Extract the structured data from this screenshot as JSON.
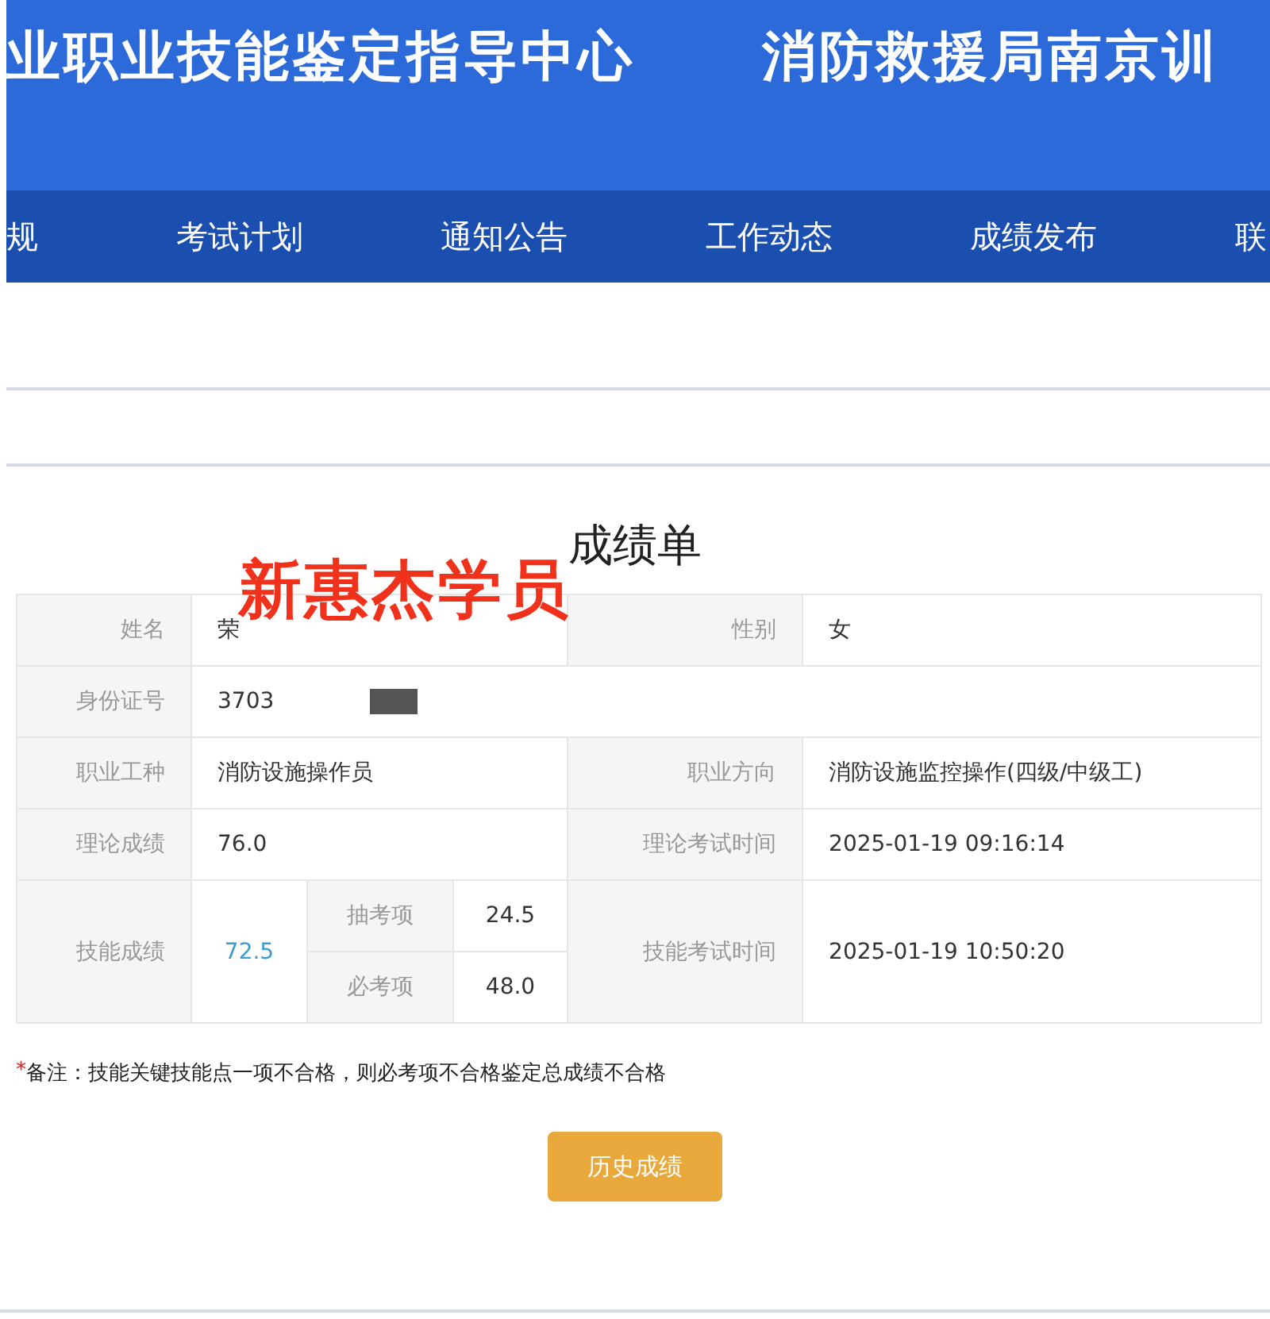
{
  "header": {
    "titles": [
      "业职业技能鉴定指导中心",
      "消防救援局南京训"
    ]
  },
  "nav": {
    "items": [
      "规",
      "考试计划",
      "通知公告",
      "工作动态",
      "成绩发布",
      "联"
    ]
  },
  "score_sheet": {
    "title": "成绩单",
    "annotation": "新惠杰学员",
    "name": {
      "label": "姓名",
      "value": "荣"
    },
    "gender": {
      "label": "性别",
      "value": "女"
    },
    "id_number": {
      "label": "身份证号",
      "value": "3703"
    },
    "occupation": {
      "label": "职业工种",
      "value": "消防设施操作员"
    },
    "direction": {
      "label": "职业方向",
      "value": "消防设施监控操作(四级/中级工)"
    },
    "theory_score": {
      "label": "理论成绩",
      "value": "76.0"
    },
    "theory_time": {
      "label": "理论考试时间",
      "value": "2025-01-19 09:16:14"
    },
    "skill_score": {
      "label": "技能成绩",
      "value": "72.5"
    },
    "skill_items": [
      {
        "label": "抽考项",
        "value": "24.5"
      },
      {
        "label": "必考项",
        "value": "48.0"
      }
    ],
    "skill_time": {
      "label": "技能考试时间",
      "value": "2025-01-19 10:50:20"
    }
  },
  "note": {
    "mark": "*",
    "text": "备注：技能关键技能点一项不合格，则必考项不合格鉴定总成绩不合格"
  },
  "buttons": [
    "历史成绩"
  ]
}
